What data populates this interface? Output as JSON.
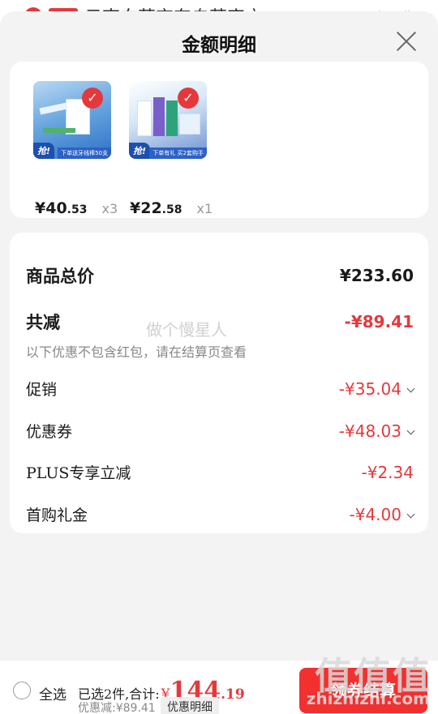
{
  "background": {
    "tag": "自营",
    "title": "云南白药京东自营官方…",
    "right": "已免运费"
  },
  "sheet": {
    "title": "金额明细"
  },
  "products": [
    {
      "price_int": "¥40",
      "price_dec": ".53",
      "qty": "x3",
      "badge": "抢!",
      "banner": "下单送牙线棒50支"
    },
    {
      "price_int": "¥22",
      "price_dec": ".58",
      "qty": "x1",
      "badge": "抢!",
      "banner": "下单有礼 买2套购手"
    }
  ],
  "summary": {
    "total_label": "商品总价",
    "total_value": "¥233.60",
    "reduce_label": "共减",
    "reduce_value": "-¥89.41",
    "note": "以下优惠不包含红包，请在结算页查看",
    "watermark": "做个慢星人",
    "items": [
      {
        "label": "促销",
        "value": "-¥35.04"
      },
      {
        "label": "优惠券",
        "value": "-¥48.03"
      },
      {
        "label": "PLUS专享立减",
        "value": "-¥2.34"
      },
      {
        "label": "首购礼金",
        "value": "-¥4.00"
      }
    ]
  },
  "bottom": {
    "select_all": "全选",
    "selected_text": "已选2件,合计:",
    "currency": "¥",
    "total_int": "144",
    "total_dec": ".19",
    "saved": "优惠减:¥89.41",
    "detail_button": "优惠明细",
    "checkout_button": "领券结算"
  },
  "overlay": {
    "site_mark": "值值值",
    "site_url": "zhizhizhi.com"
  },
  "colors": {
    "accent": "#e4393c",
    "checkout": "#f23030"
  }
}
